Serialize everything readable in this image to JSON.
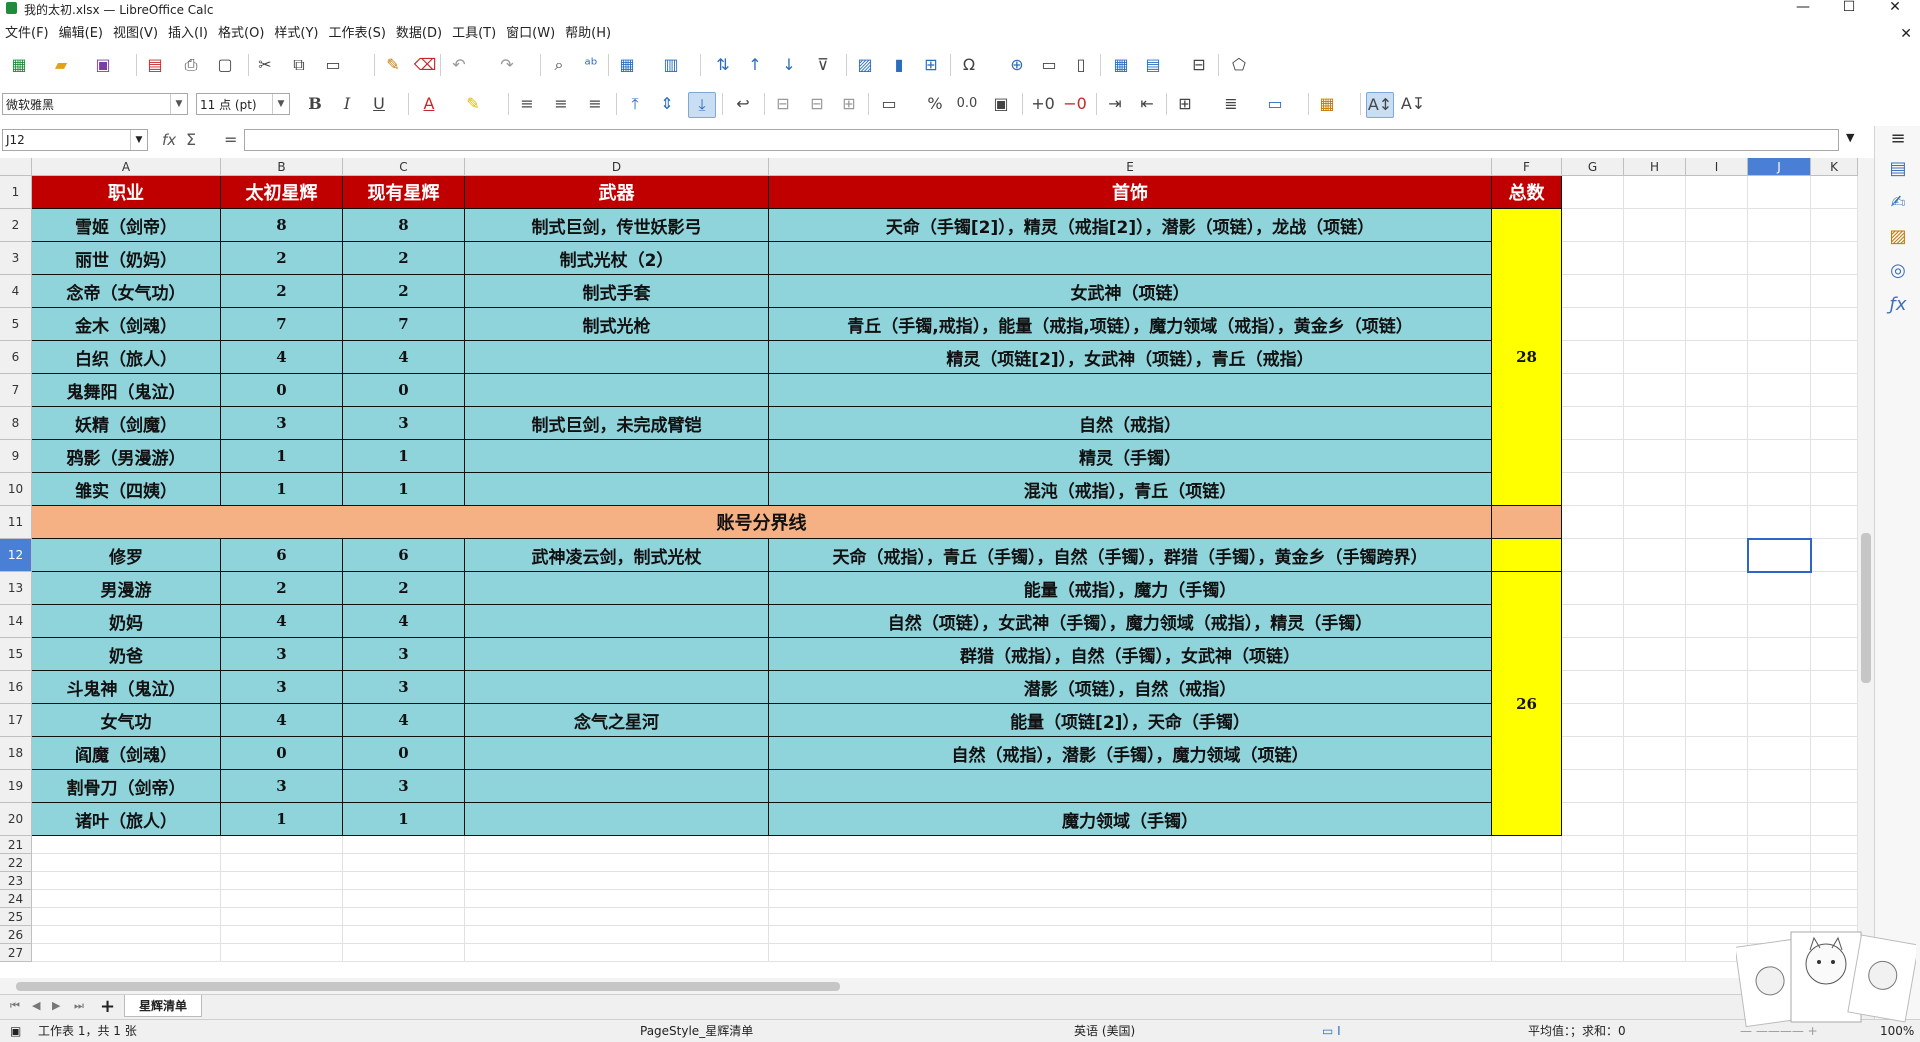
{
  "window": {
    "title": "我的太初.xlsx — LibreOffice Calc"
  },
  "menu": [
    "文件(F)",
    "编辑(E)",
    "视图(V)",
    "插入(I)",
    "格式(O)",
    "样式(Y)",
    "工作表(S)",
    "数据(D)",
    "工具(T)",
    "窗口(W)",
    "帮助(H)"
  ],
  "formatting": {
    "font_name": "微软雅黑",
    "font_size": "11 点 (pt)",
    "bold": "B",
    "italic": "I",
    "underline": "U",
    "percent": "%",
    "decimal": "0.0"
  },
  "formula_bar": {
    "name_box": "J12",
    "fx": "fx",
    "sigma": "Σ",
    "equals": "=",
    "content": ""
  },
  "columns": [
    "A",
    "B",
    "C",
    "D",
    "E",
    "F",
    "G",
    "H",
    "I",
    "J",
    "K"
  ],
  "rows": [
    "1",
    "2",
    "3",
    "4",
    "5",
    "6",
    "7",
    "8",
    "9",
    "10",
    "11",
    "12",
    "13",
    "14",
    "15",
    "16",
    "17",
    "18",
    "19",
    "20",
    "21",
    "22",
    "23",
    "24",
    "25",
    "26",
    "27"
  ],
  "sheet": {
    "headers": [
      "职业",
      "太初星辉",
      "现有星辉",
      "武器",
      "首饰",
      "总数"
    ],
    "group1": [
      [
        "雪姬（剑帝）",
        "8",
        "8",
        "制式巨剑，传世妖影弓",
        "天命（手镯[2]），精灵（戒指[2]），潜影（项链），龙战（项链）"
      ],
      [
        "丽世（奶妈）",
        "2",
        "2",
        "制式光杖（2）",
        ""
      ],
      [
        "念帝（女气功）",
        "2",
        "2",
        "制式手套",
        "女武神（项链）"
      ],
      [
        "金木（剑魂）",
        "7",
        "7",
        "制式光枪",
        "青丘（手镯,戒指），能量（戒指,项链），魔力领域（戒指），黄金乡（项链）"
      ],
      [
        "白织（旅人）",
        "4",
        "4",
        "",
        "精灵（项链[2]），女武神（项链），青丘（戒指）"
      ],
      [
        "鬼舞阳（鬼泣）",
        "0",
        "0",
        "",
        ""
      ],
      [
        "妖精（剑魔）",
        "3",
        "3",
        "制式巨剑，未完成臂铠",
        "自然（戒指）"
      ],
      [
        "鸦影（男漫游）",
        "1",
        "1",
        "",
        "精灵（手镯）"
      ],
      [
        "雏实（四姨）",
        "1",
        "1",
        "",
        "混沌（戒指），青丘（项链）"
      ]
    ],
    "group1_total": "28",
    "divider": "账号分界线",
    "group2": [
      [
        "修罗",
        "6",
        "6",
        "武神凌云剑，制式光杖",
        "天命（戒指），青丘（手镯），自然（手镯），群猎（手镯），黄金乡（手镯跨界）"
      ],
      [
        "男漫游",
        "2",
        "2",
        "",
        "能量（戒指），魔力（手镯）"
      ],
      [
        "奶妈",
        "4",
        "4",
        "",
        "自然（项链），女武神（手镯），魔力领域（戒指），精灵（手镯）"
      ],
      [
        "奶爸",
        "3",
        "3",
        "",
        "群猎（戒指），自然（手镯），女武神（项链）"
      ],
      [
        "斗鬼神（鬼泣）",
        "3",
        "3",
        "",
        "潜影（项链），自然（戒指）"
      ],
      [
        "女气功",
        "4",
        "4",
        "念气之星河",
        "能量（项链[2]），天命（手镯）"
      ],
      [
        "阎魔（剑魂）",
        "0",
        "0",
        "",
        "自然（戒指），潜影（手镯），魔力领域（项链）"
      ],
      [
        "割骨刀（剑帝）",
        "3",
        "3",
        "",
        ""
      ],
      [
        "诸叶（旅人）",
        "1",
        "1",
        "",
        "魔力领域（手镯）"
      ]
    ],
    "group2_total": "26"
  },
  "tabs": {
    "add": "+",
    "active": "星辉清单"
  },
  "status": {
    "sheet_info": "工作表 1，共 1 张",
    "page_style": "PageStyle_星辉清单",
    "language": "英语 (美国)",
    "summary": "平均值：；求和：0",
    "zoom": "100%"
  }
}
